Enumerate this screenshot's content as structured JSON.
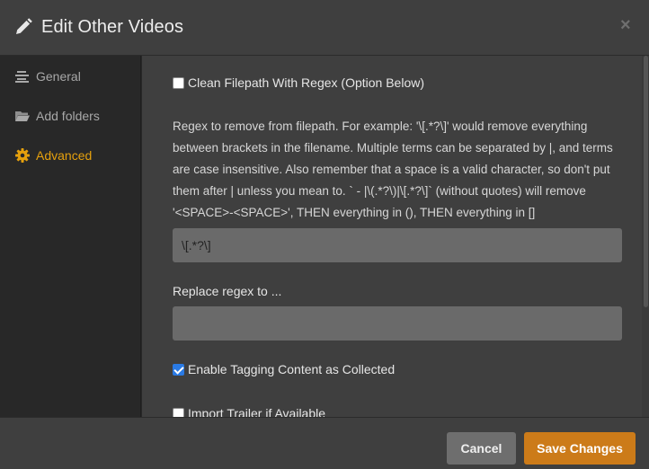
{
  "header": {
    "title": "Edit Other Videos",
    "close_symbol": "×",
    "icon": "pencil-icon"
  },
  "sidebar": {
    "items": [
      {
        "label": "General",
        "icon": "list-icon",
        "active": false
      },
      {
        "label": "Add folders",
        "icon": "folder-icon",
        "active": false
      },
      {
        "label": "Advanced",
        "icon": "gear-icon",
        "active": true
      }
    ]
  },
  "content": {
    "clean_filepath": {
      "label": "Clean Filepath With Regex (Option Below)",
      "checked": false
    },
    "regex_help": "Regex to remove from filepath. For example: '\\[.*?\\]' would remove everything between brackets in the filename. Multiple terms can be separated by |, and terms are case insensitive. Also remember that a space is a valid character, so don't put them after | unless you mean to. ` - |\\(.*?\\)|\\[.*?\\]` (without quotes) will remove '<SPACE>-<SPACE>', THEN everything in (), THEN everything in []",
    "regex_input": {
      "value": "\\[.*?\\]"
    },
    "replace_label": "Replace regex to ...",
    "replace_input": {
      "value": ""
    },
    "enable_tagging": {
      "label": "Enable Tagging Content as Collected",
      "checked": true
    },
    "import_trailer": {
      "label": "Import Trailer if Available",
      "checked": false
    }
  },
  "footer": {
    "cancel_label": "Cancel",
    "save_label": "Save Changes"
  },
  "colors": {
    "accent": "#e5a00d",
    "save_button": "#cc7b19",
    "checkbox_checked": "#2a7ae4"
  }
}
